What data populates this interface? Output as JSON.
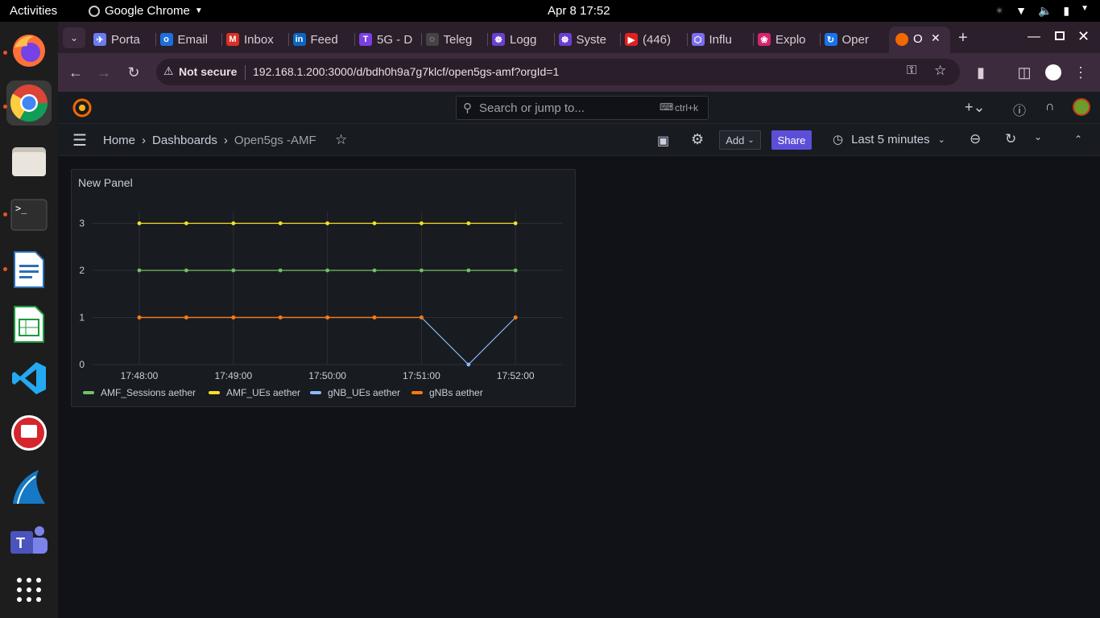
{
  "system": {
    "activities": "Activities",
    "app_name": "Google Chrome",
    "clock": "Apr 8  17:52"
  },
  "browser": {
    "tabs": [
      {
        "label": "Porta",
        "color": "#6b7cf0",
        "glyph": "✈"
      },
      {
        "label": "Email",
        "color": "#1e6fd9",
        "glyph": "o"
      },
      {
        "label": "Inbox",
        "color": "#d93025",
        "glyph": "M"
      },
      {
        "label": "Feed",
        "color": "#0a66c2",
        "glyph": "in"
      },
      {
        "label": "5G - D",
        "color": "#7b3fe4",
        "glyph": "T"
      },
      {
        "label": "Teleg",
        "color": "#444444",
        "glyph": "◌"
      },
      {
        "label": "Logg",
        "color": "#6a3fd1",
        "glyph": "☸"
      },
      {
        "label": "Syste",
        "color": "#6a3fd1",
        "glyph": "☸"
      },
      {
        "label": "(446)",
        "color": "#e02020",
        "glyph": "▶"
      },
      {
        "label": "Influ",
        "color": "#7b6cf0",
        "glyph": "⬡"
      },
      {
        "label": "Explo",
        "color": "#d6246e",
        "glyph": "❀"
      },
      {
        "label": "Oper",
        "color": "#1a73e8",
        "glyph": "↻"
      }
    ],
    "active_tab_label": "O",
    "security_label": "Not secure",
    "url": "192.168.1.200:3000/d/bdh0h9a7g7klcf/open5gs-amf?orgId=1"
  },
  "grafana": {
    "search_placeholder": "Search or jump to...",
    "search_shortcut": "ctrl+k",
    "breadcrumb": {
      "home": "Home",
      "dashboards": "Dashboards",
      "current": "Open5gs -AMF"
    },
    "add_label": "Add",
    "share_label": "Share",
    "time_range": "Last 5 minutes"
  },
  "panel": {
    "title": "New Panel"
  },
  "chart_data": {
    "type": "line",
    "title": "New Panel",
    "x": [
      "17:47:45",
      "17:48:15",
      "17:48:45",
      "17:49:15",
      "17:49:45",
      "17:50:15",
      "17:50:45",
      "17:51:15",
      "17:51:45"
    ],
    "x_tick_labels": [
      "17:48:00",
      "17:49:00",
      "17:50:00",
      "17:51:00",
      "17:52:00"
    ],
    "ylim": [
      0,
      3
    ],
    "y_tick_labels": [
      "0",
      "1",
      "2",
      "3"
    ],
    "grid": true,
    "legend_position": "bottom-left",
    "series": [
      {
        "name": "AMF_Sessions aether",
        "color": "#73bf69",
        "values": [
          2,
          2,
          2,
          2,
          2,
          2,
          2,
          2,
          2
        ]
      },
      {
        "name": "AMF_UEs aether",
        "color": "#fade2a",
        "values": [
          3,
          3,
          3,
          3,
          3,
          3,
          3,
          3,
          3
        ]
      },
      {
        "name": "gNB_UEs aether",
        "color": "#8ab8ff",
        "values": [
          1,
          1,
          1,
          1,
          1,
          1,
          1,
          0,
          1
        ]
      },
      {
        "name": "gNBs aether",
        "color": "#ff780a",
        "values": [
          1,
          1,
          1,
          1,
          1,
          1,
          1,
          null,
          1
        ]
      }
    ]
  }
}
